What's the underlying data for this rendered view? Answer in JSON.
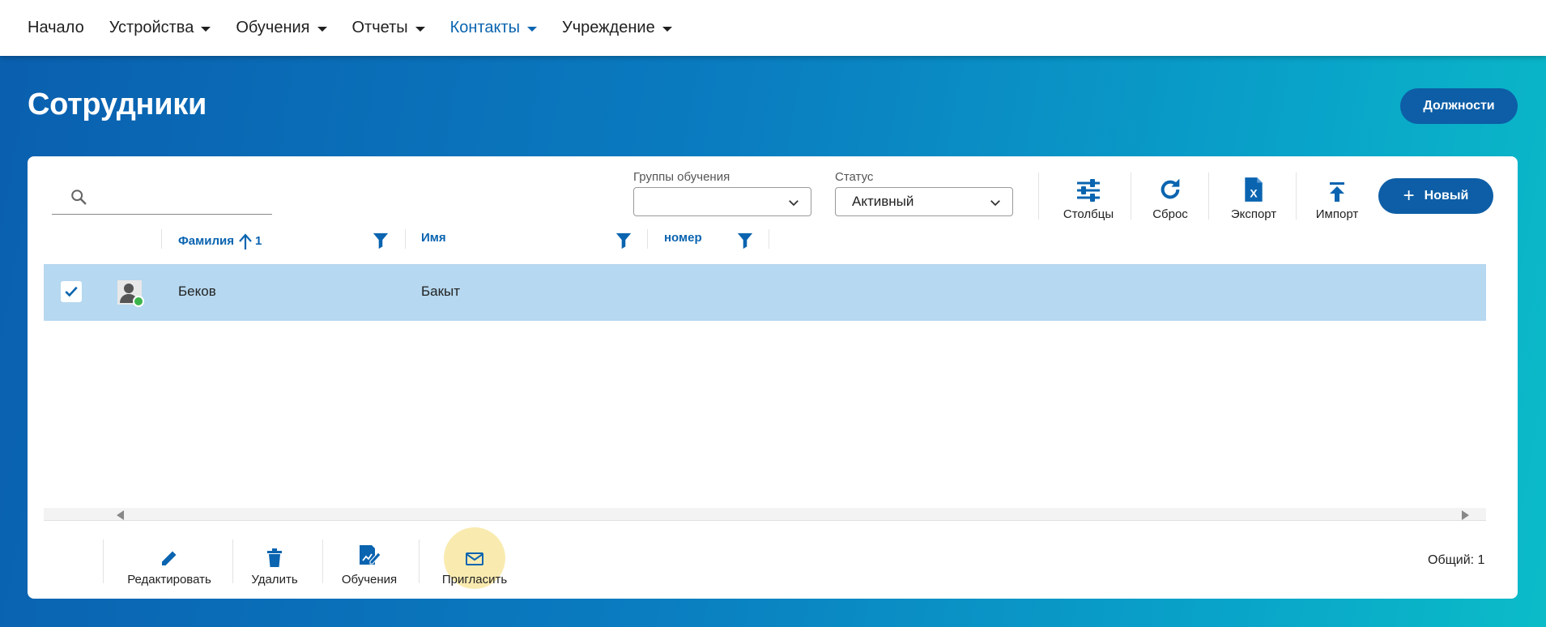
{
  "nav": {
    "items": [
      {
        "label": "Начало",
        "caret": false,
        "active": false
      },
      {
        "label": "Устройства",
        "caret": true,
        "active": false
      },
      {
        "label": "Обучения",
        "caret": true,
        "active": false
      },
      {
        "label": "Отчеты",
        "caret": true,
        "active": false
      },
      {
        "label": "Контакты",
        "caret": true,
        "active": true
      },
      {
        "label": "Учреждение",
        "caret": true,
        "active": false
      }
    ]
  },
  "page": {
    "title": "Сотрудники",
    "positions_button": "Должности"
  },
  "toolbar": {
    "search_value": "",
    "groups_label": "Группы обучения",
    "groups_value": "",
    "status_label": "Статус",
    "status_value": "Активный",
    "columns": "Столбцы",
    "reset": "Сброс",
    "export": "Экспорт",
    "import": "Импорт",
    "new": "Новый"
  },
  "table": {
    "headers": {
      "lastname": "Фамилия",
      "sort_index": "1",
      "firstname": "Имя",
      "number": "номер"
    },
    "rows": [
      {
        "lastname": "Беков",
        "firstname": "Бакыт",
        "number": "",
        "selected": true,
        "status": "online"
      }
    ]
  },
  "actions": {
    "edit": "Редактировать",
    "delete": "Удалить",
    "trainings": "Обучения",
    "invite": "Пригласить"
  },
  "footer": {
    "total": "Общий: 1"
  },
  "colors": {
    "accent": "#0a64b0",
    "button": "#0d5ea6",
    "selected_row": "#b6d8f0",
    "online": "#3bb54a",
    "highlight": "#f8e8a2"
  }
}
